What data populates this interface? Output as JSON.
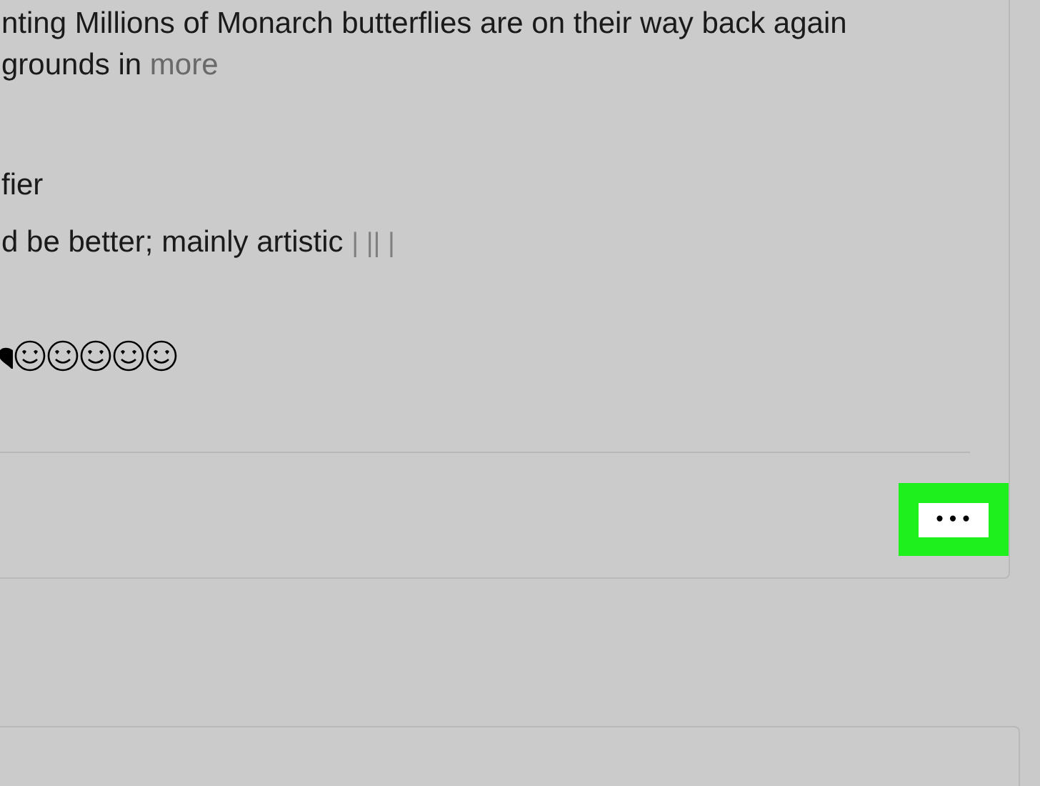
{
  "post": {
    "paragraph": [
      {
        "kind": "line",
        "text": "nting Millions of Monarch butterflies are on their way back again"
      },
      {
        "kind": "text",
        "text": "grounds in"
      },
      {
        "kind": "link",
        "text": "more"
      }
    ],
    "comments": [
      {
        "text": "fier"
      },
      {
        "text": "d be better; mainly artistic",
        "trail": "| || |"
      }
    ],
    "reactions": [
      {
        "kind": "heart"
      },
      {
        "kind": "smiley"
      },
      {
        "kind": "smiley"
      },
      {
        "kind": "smiley"
      },
      {
        "kind": "smiley"
      },
      {
        "kind": "smiley"
      }
    ],
    "menu_button": {
      "label": "•••",
      "highlighted": true
    }
  }
}
